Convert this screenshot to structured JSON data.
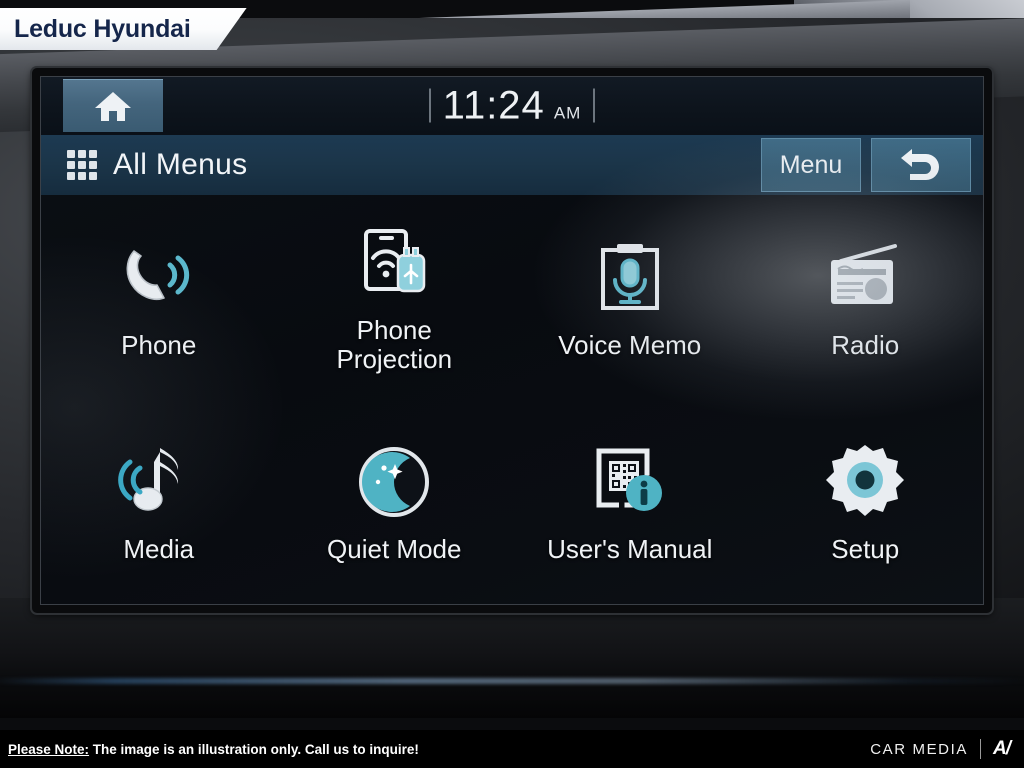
{
  "banner": {
    "dealer_name": "Leduc Hyundai"
  },
  "infotainment": {
    "status_bar": {
      "home_button": {
        "icon": "home-icon"
      },
      "clock": {
        "time": "11:24",
        "period": "AM"
      }
    },
    "title_bar": {
      "grid_icon": "grid-menu-icon",
      "title": "All Menus",
      "menu_button": "Menu",
      "back_button_icon": "back-arrow-icon"
    },
    "menu_items": [
      {
        "label": "Phone",
        "icon": "phone-handset-icon"
      },
      {
        "label": "Phone\nProjection",
        "label_line1": "Phone",
        "label_line2": "Projection",
        "icon": "phone-projection-icon"
      },
      {
        "label": "Voice Memo",
        "icon": "voice-memo-icon"
      },
      {
        "label": "Radio",
        "icon": "radio-icon"
      },
      {
        "label": "Media",
        "icon": "music-note-icon"
      },
      {
        "label": "Quiet Mode",
        "icon": "moon-stars-icon"
      },
      {
        "label": "User's Manual",
        "icon": "qr-manual-icon"
      },
      {
        "label": "Setup",
        "icon": "gear-icon"
      }
    ]
  },
  "footer": {
    "note_label": "Please Note:",
    "note_text": " The image is an illustration only. Call us to inquire!",
    "brand_text": "CAR MEDIA",
    "brand_mark": "A/"
  },
  "colors": {
    "accent_teal": "#6fc3cf",
    "button_blue": "#376079",
    "title_blue": "#1b3549",
    "banner_navy": "#15264b"
  }
}
